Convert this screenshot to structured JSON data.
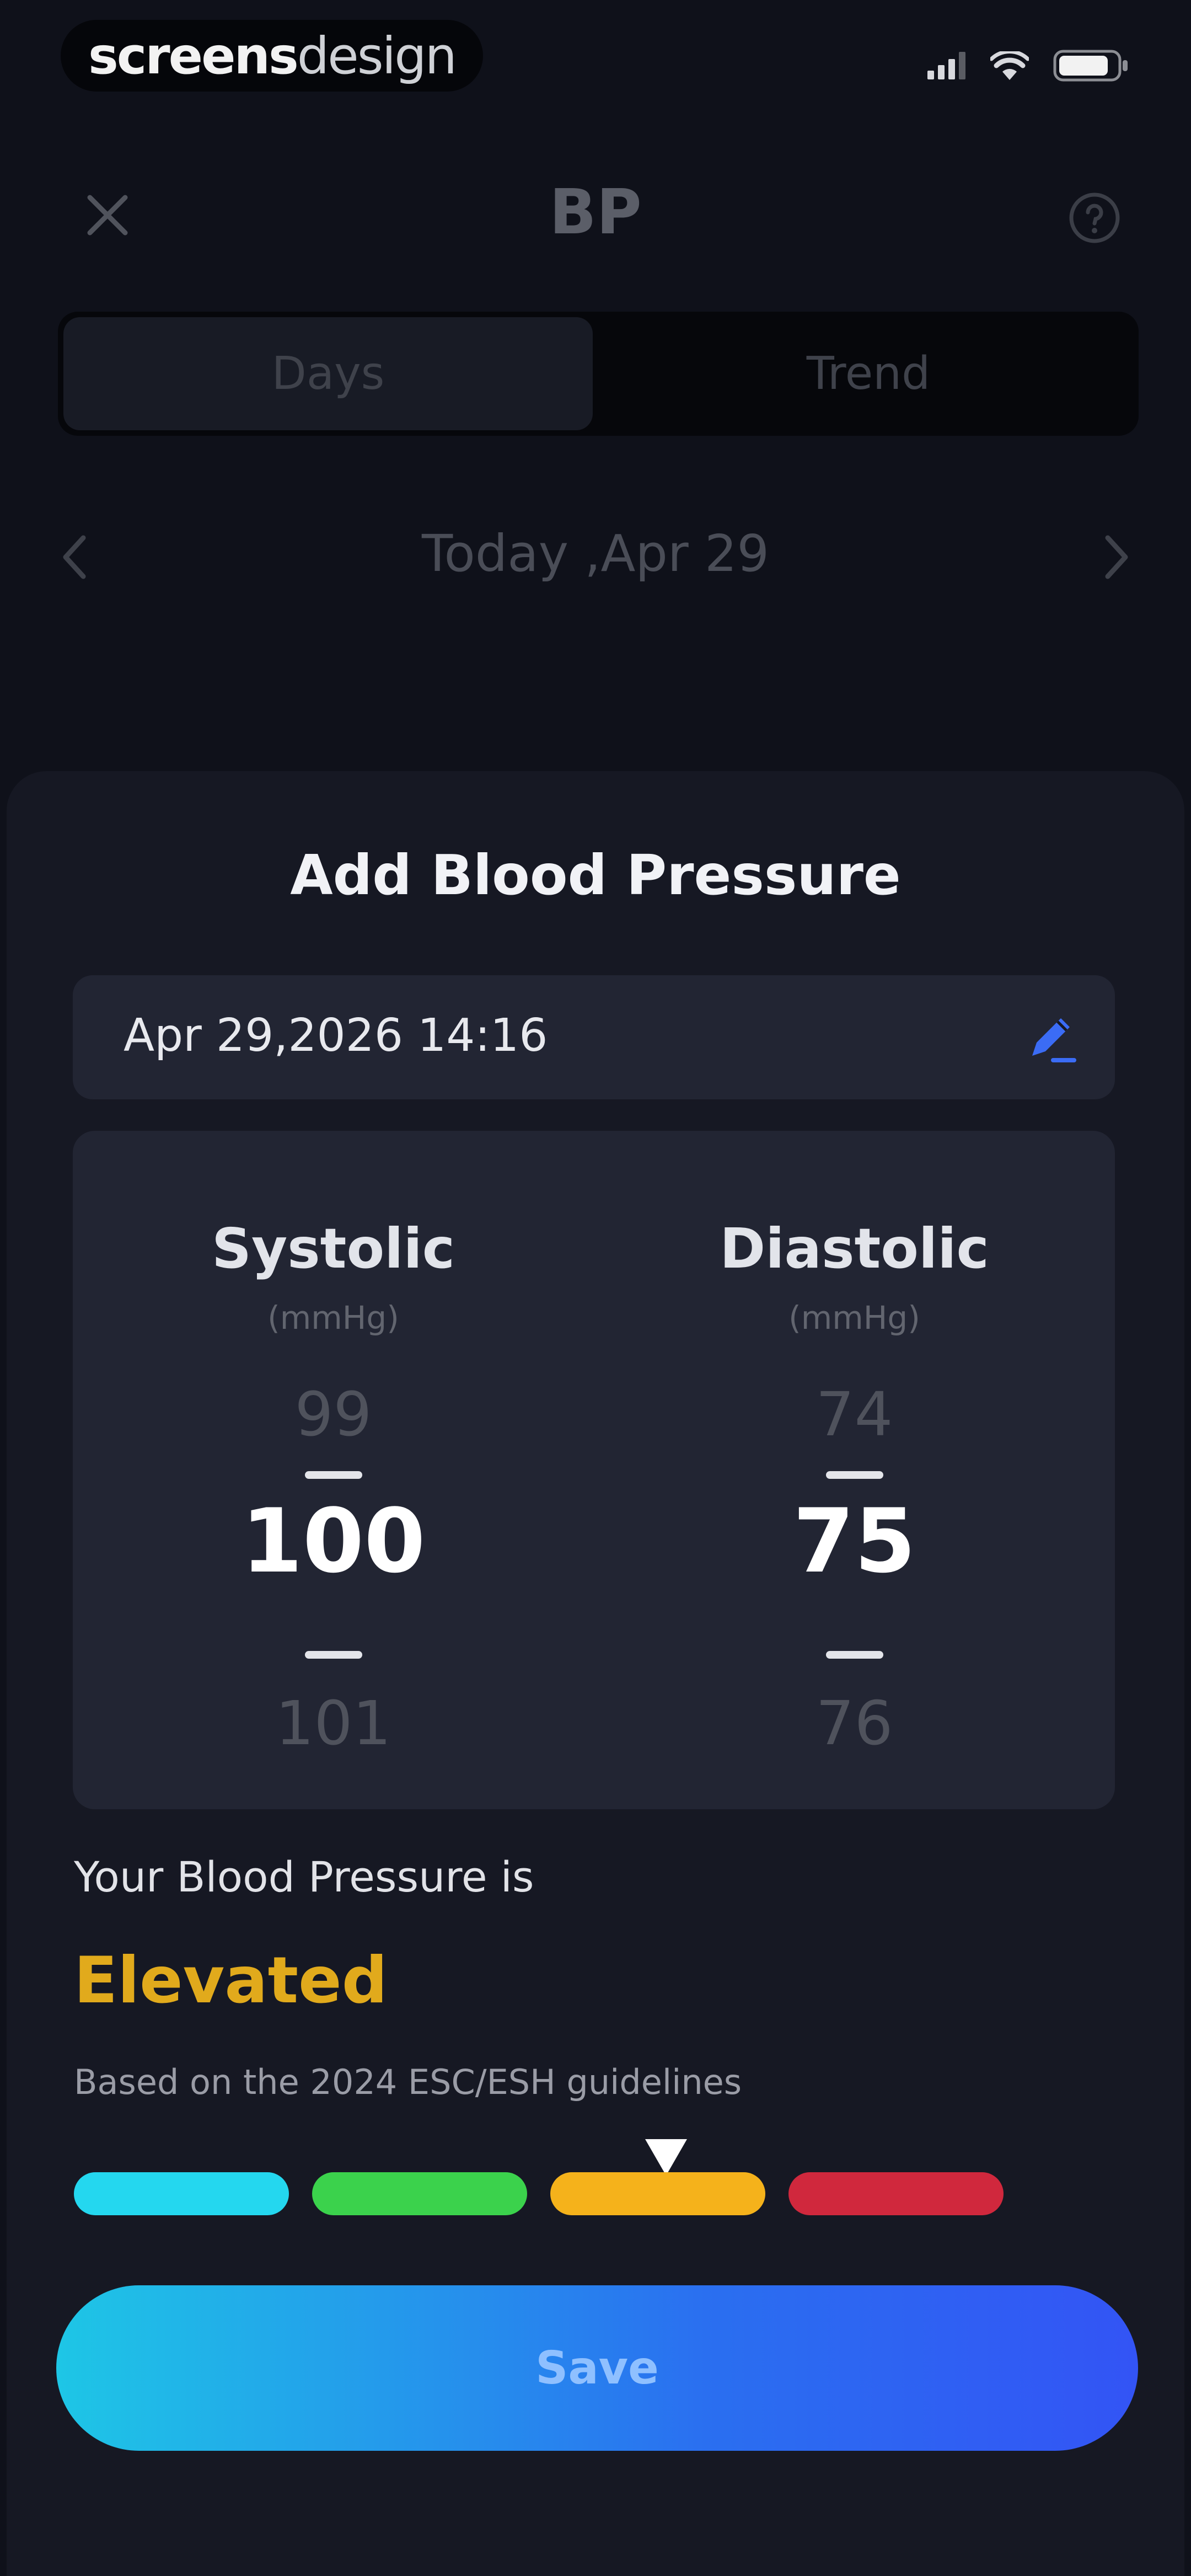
{
  "status_bar": {
    "brand_bold": "screens",
    "brand_light": "design",
    "icons": [
      "signal-icon",
      "wifi-icon",
      "battery-icon"
    ]
  },
  "header": {
    "title": "BP",
    "close_icon": "close-icon",
    "help_icon": "help-icon"
  },
  "segment": {
    "tabs": [
      {
        "label": "Days",
        "active": true
      },
      {
        "label": "Trend",
        "active": false
      }
    ]
  },
  "date_nav": {
    "label": "Today ,Apr 29"
  },
  "sheet": {
    "title": "Add Blood Pressure",
    "datetime": "Apr 29,2026 14:16",
    "systolic": {
      "label": "Systolic",
      "unit": "(mmHg)",
      "prev": "99",
      "current": "100",
      "next": "101"
    },
    "diastolic": {
      "label": "Diastolic",
      "unit": "(mmHg)",
      "prev": "74",
      "current": "75",
      "next": "76"
    },
    "result": {
      "label": "Your Blood Pressure is",
      "status": "Elevated",
      "basis": "Based on the 2024 ESC/ESH guidelines",
      "status_color": "#e1aa1c"
    },
    "scale": {
      "colors": [
        "#24d7ef",
        "#3bd24c",
        "#f5b21b",
        "#d0283d"
      ],
      "selected_index": 2
    },
    "save_label": "Save"
  }
}
